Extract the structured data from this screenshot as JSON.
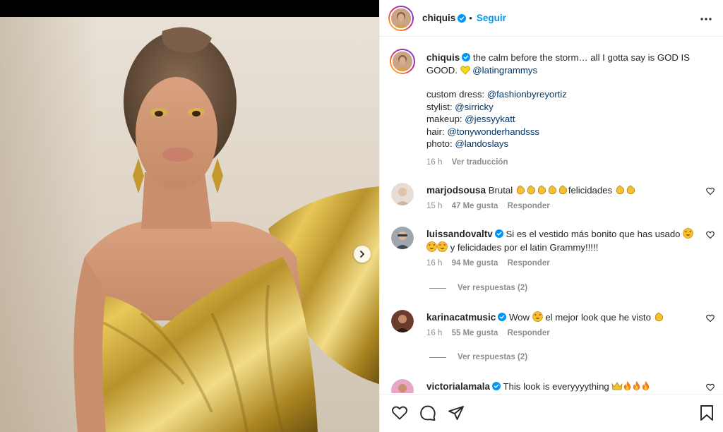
{
  "post": {
    "username": "chiquis",
    "follow_label": "Seguir",
    "caption": {
      "line1_text": " the calm before the storm… all I gotta say is GOD IS GOOD. ",
      "mention_main": "@latingrammys",
      "credits": [
        {
          "label": "custom dress: ",
          "handle": "@fashionbyreyortiz"
        },
        {
          "label": "stylist: ",
          "handle": "@sirricky"
        },
        {
          "label": "makeup: ",
          "handle": "@jessyykatt"
        },
        {
          "label": "hair: ",
          "handle": "@tonywonderhandsss"
        },
        {
          "label": "photo: ",
          "handle": "@landoslays"
        }
      ],
      "time": "16 h",
      "translate_label": "Ver traducción"
    }
  },
  "comments": [
    {
      "username": "marjodsousa",
      "verified": false,
      "text_a": " Brutal ",
      "text_b": "felicidades ",
      "time": "15 h",
      "likes": "47 Me gusta",
      "reply": "Responder"
    },
    {
      "username": "luissandovaltv",
      "verified": true,
      "text_a": " Si es el vestido más bonito que has usado ",
      "text_b": " y felicidades por el latin Grammy!!!!!",
      "time": "16 h",
      "likes": "94 Me gusta",
      "reply": "Responder",
      "replies_label": "Ver respuestas (2)"
    },
    {
      "username": "karinacatmusic",
      "verified": true,
      "text_a": " Wow ",
      "text_b": " el mejor look que he visto ",
      "time": "16 h",
      "likes": "55 Me gusta",
      "reply": "Responder",
      "replies_label": "Ver respuestas (2)"
    },
    {
      "username": "victorialamala",
      "verified": true,
      "text_a": " This look is everyyyything ",
      "text_b": ""
    }
  ],
  "icons": {
    "verified": "verified-badge-icon",
    "more": "more-horizontal-icon",
    "next": "chevron-right-icon",
    "like": "heart-icon",
    "comment": "comment-bubble-icon",
    "share": "paper-plane-icon",
    "save": "bookmark-icon"
  },
  "colors": {
    "accent": "#0095f6",
    "link": "#00376b",
    "meta": "#8e8e8e",
    "dress_gold": "#c9a22a"
  }
}
